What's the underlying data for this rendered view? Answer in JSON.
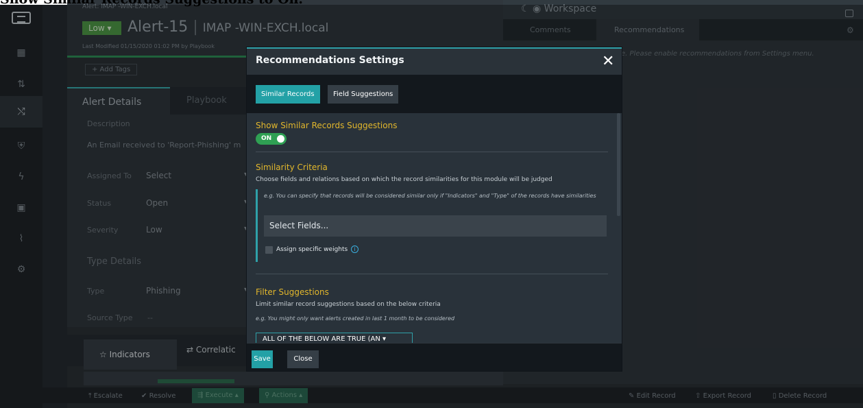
{
  "caption": "Show Similar Records Suggestions to On.",
  "nav": {
    "icons": [
      "dashboard-icon",
      "queue-icon",
      "shuffle-icon",
      "shield-icon",
      "bolt-icon",
      "briefcase-icon",
      "chart-icon",
      "settings-icon"
    ]
  },
  "header": {
    "crumb": "Alert: IMAP -WIN-EXCH.local",
    "severity_badge": "Low ▾",
    "title_id": "Alert-15",
    "title_sep": "|",
    "title_host": "IMAP -WIN-EXCH.local",
    "modified": "Last Modified 01/15/2020 01:02 PM by Playbook",
    "add_tags": "+ Add Tags"
  },
  "record": {
    "tab_alert": "Alert Details",
    "tab_playbook": "Playbook",
    "description_label": "Description",
    "description": "An Email received to 'Report-Phishing' m",
    "fields": [
      {
        "label": "Assigned To",
        "value": "Select"
      },
      {
        "label": "Status",
        "value": "Open"
      },
      {
        "label": "Severity",
        "value": "Low"
      }
    ],
    "type_details": "Type Details",
    "type_label": "Type",
    "type_value": "Phishing",
    "source_label": "Source Type",
    "source_value": "--",
    "bottom_tabs": {
      "indicators": "Indicators",
      "correlations": "Correlatic"
    }
  },
  "footer": {
    "escalate": "Escalate",
    "resolve": "Resolve",
    "execute": "Execute",
    "actions": "Actions",
    "edit": "Edit Record",
    "export": "Export Record",
    "delete": "Delete Record"
  },
  "workspace": {
    "title": "Workspace",
    "tab_comments": "Comments",
    "tab_recommendations": "Recommendations",
    "message": "e. Please enable recommendations from Settings menu."
  },
  "modal": {
    "title": "Recommendations Settings",
    "tab_similar": "Similar Records",
    "tab_field": "Field Suggestions",
    "show_similar_title": "Show Similar Records Suggestions",
    "toggle_label": "ON",
    "toggle_state": true,
    "similarity_title": "Similarity Criteria",
    "similarity_help": "Choose fields and relations based on which the record similarities for this module will be judged",
    "similarity_example": "e.g. You can specify that records will be considered similar only if \"Indicators\" and \"Type\" of the records have similarities",
    "select_fields": "Select Fields...",
    "assign_weights": "Assign specific weights",
    "filter_title": "Filter Suggestions",
    "filter_help": "Limit similar record suggestions based on the below criteria",
    "filter_example": "e.g. You might only want alerts created in last 1 month to be considered",
    "filter_select": "ALL OF THE BELOW ARE TRUE (AN ▾",
    "save": "Save",
    "close": "Close"
  },
  "colors": {
    "accent": "#23a1a6",
    "section_title": "#e2b72c",
    "toggle_on": "#2fa053"
  }
}
